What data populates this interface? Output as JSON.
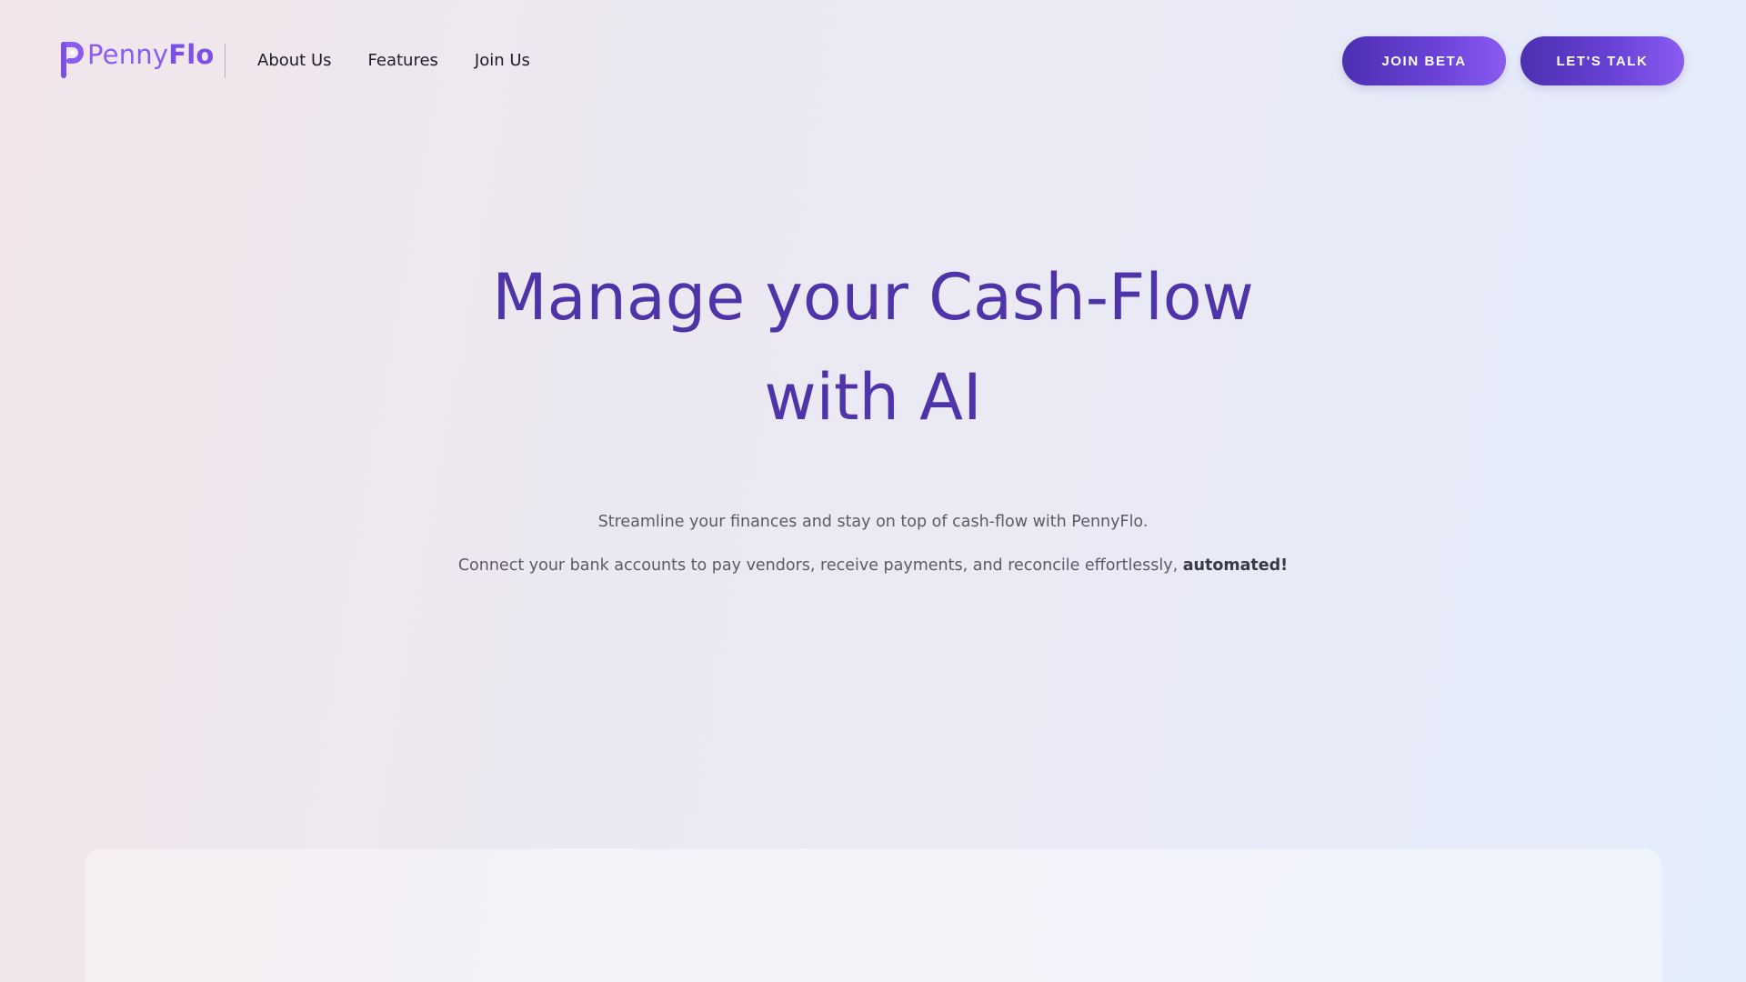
{
  "brand": {
    "logo_text_light": "Penny",
    "logo_text_bold": "Flo",
    "logo_icon": "pennyflo-p-icon",
    "accent_color": "#7c4fe8"
  },
  "nav": {
    "items": [
      {
        "label": "About Us"
      },
      {
        "label": "Features"
      },
      {
        "label": "Join Us"
      }
    ]
  },
  "actions": {
    "join_beta_label": "JOIN BETA",
    "lets_talk_label": "LET'S TALK",
    "button_color": "#5a37c4"
  },
  "hero": {
    "title_line1": "Manage your Cash-Flow",
    "title_line2": "with AI",
    "title_color": "#4f33a8",
    "subtitle_line1": "Streamline your finances and stay on top of cash-flow with PennyFlo.",
    "subtitle_line2_prefix": "Connect your bank accounts to pay vendors, receive payments, and reconcile effortlessly, ",
    "subtitle_line2_emphasis": "automated!"
  }
}
